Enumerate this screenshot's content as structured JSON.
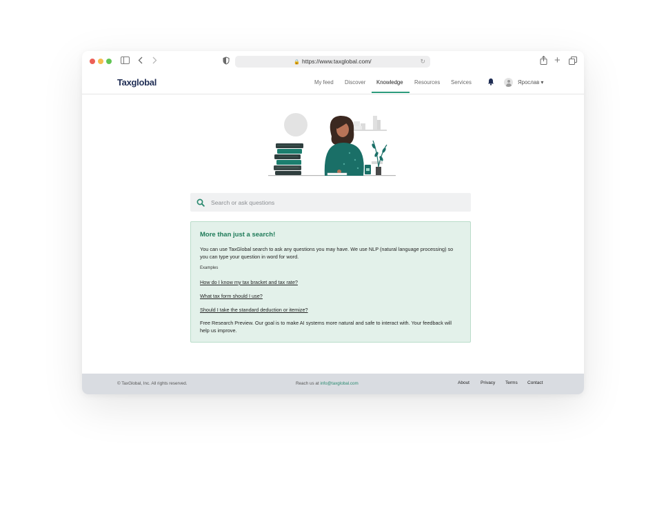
{
  "browser": {
    "url": "https://www.taxglobal.com/",
    "icons": [
      "sidebar-icon",
      "back-icon",
      "forward-icon",
      "shield-icon",
      "lock-icon",
      "reload-icon",
      "share-icon",
      "new-tab-icon",
      "tabs-icon"
    ]
  },
  "nav": {
    "logo": "Taxglobal",
    "items": [
      "My feed",
      "Discover",
      "Knowledge",
      "Resources",
      "Services"
    ],
    "active": "Knowledge",
    "user_name": "Ярослав ▾",
    "accent": "#2b9a7b"
  },
  "search": {
    "placeholder": "Search or ask questions"
  },
  "info": {
    "title": "More than just a search!",
    "description": "You can use TaxGlobal search to ask any questions you may have. We use NLP (natural language processing) so you can type your question in word for word.",
    "examples_label": "Examples",
    "examples": [
      "How do I know my tax bracket and tax rate?",
      "What tax form should I use?",
      "Should I take the standard deduction or itemize?"
    ],
    "footer": "Free Research Preview. Our goal is to make AI systems more natural and safe to interact with. Your feedback will help us improve.",
    "bg_color": "#e3f1ea",
    "title_color": "#1e7a58"
  },
  "footer": {
    "copyright": "© TaxGlobal, Inc. All rights reserved.",
    "reach_prefix": "Reach us at ",
    "email": "info@taxglobal.com",
    "links": [
      "About",
      "Privacy",
      "Terms",
      "Contact"
    ]
  }
}
